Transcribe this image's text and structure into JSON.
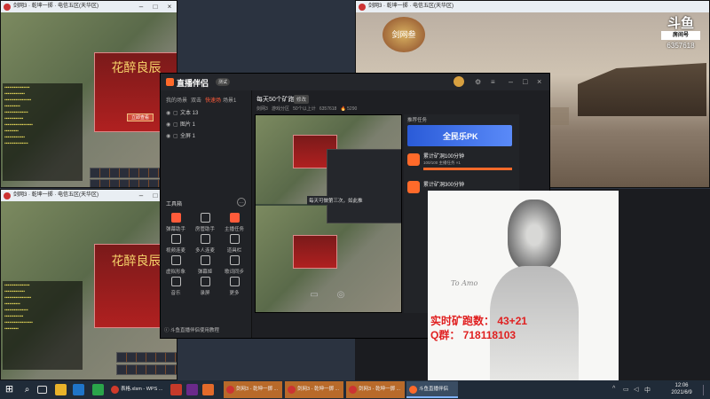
{
  "windows": {
    "game_title": "剑网3 · 乾坤一掷 · 电信五区(天华区)"
  },
  "game": {
    "banner_text": "花醉良辰",
    "panel_button": "立即查看"
  },
  "stream_overlay": {
    "douyu_logo": "斗鱼",
    "room_label": "房间号",
    "room_id": "6357618",
    "corner_logo_text": "剑网叁"
  },
  "app": {
    "brand": "直播伴侣",
    "version_badge": "测试",
    "tabs": [
      "我的场景",
      "双击",
      "快速场",
      "场景1"
    ],
    "scenes": [
      {
        "name": "文本 13"
      },
      {
        "name": "图片 1"
      },
      {
        "name": "全屏 1"
      }
    ],
    "stream_title": "每天50个矿跑",
    "stream_title_tag": "修改",
    "stream_meta": [
      "剑网3",
      "游戏分区",
      "50个以上计",
      "6357618",
      "5290"
    ],
    "tools_header": "工具箱",
    "tools": [
      {
        "label": "弹幕助手"
      },
      {
        "label": "房管助手"
      },
      {
        "label": "主播任务"
      },
      {
        "label": "视频连麦"
      },
      {
        "label": "多人连麦"
      },
      {
        "label": "道具栏"
      },
      {
        "label": "虚拟形象"
      },
      {
        "label": "弹幕姬"
      },
      {
        "label": "歌词同步"
      },
      {
        "label": "音乐"
      },
      {
        "label": "录屏"
      },
      {
        "label": "更多"
      }
    ],
    "footer_text": "斗鱼直播伴侣使用教程",
    "task_panel_title": "推荐任务",
    "task_banner": "全民乐PK",
    "tasks": [
      {
        "title": "累计矿洞100分钟",
        "sub": "100/100 主播任务 ×1"
      },
      {
        "title": "累计矿洞300分钟",
        "sub": ""
      }
    ],
    "notice_line": "每天可做第三次，如此推"
  },
  "overlay_text": {
    "line1": "实时矿跑数：  43+21",
    "line2": "Q群：  718118103",
    "signature": "To Amo"
  },
  "taskbar": {
    "tasks": [
      {
        "label": "表格.xlsm - WPS ..."
      },
      {
        "label": "剑网3 - 乾坤一掷 ..."
      },
      {
        "label": "剑网3 - 乾坤一掷 ..."
      },
      {
        "label": "剑网3 - 乾坤一掷 ..."
      },
      {
        "label": "斗鱼直播伴侣"
      }
    ],
    "time": "12:06",
    "date": "2021/6/9"
  }
}
